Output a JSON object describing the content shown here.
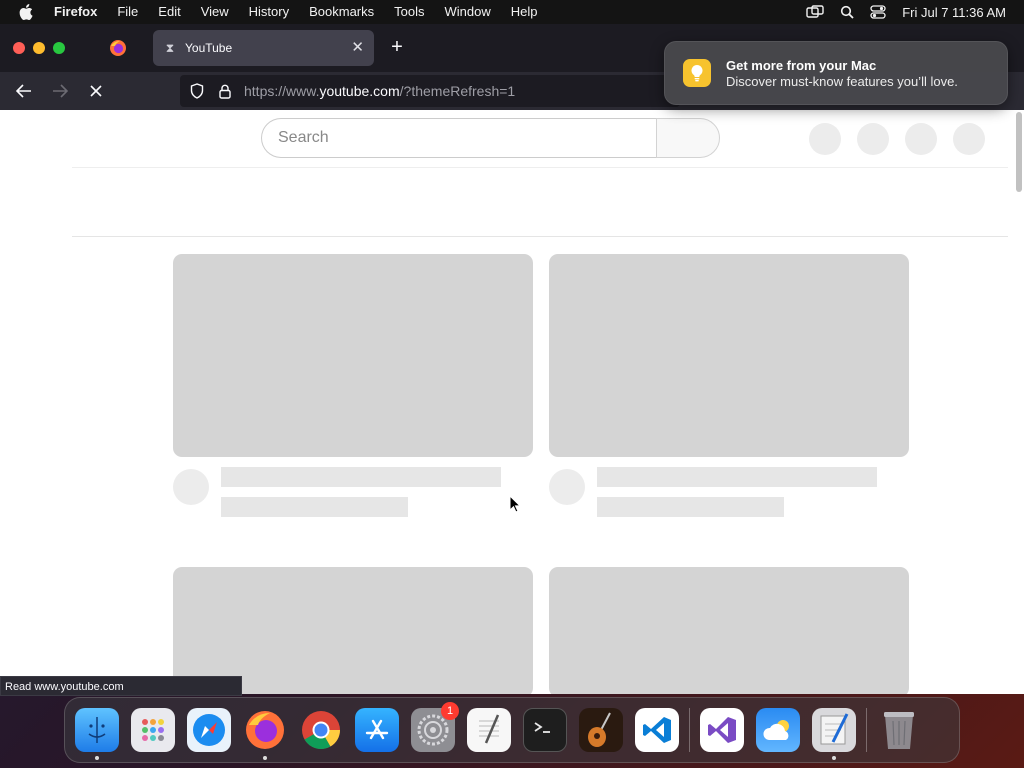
{
  "menubar": {
    "app_name": "Firefox",
    "menus": [
      "File",
      "Edit",
      "View",
      "History",
      "Bookmarks",
      "Tools",
      "Window",
      "Help"
    ],
    "datetime": "Fri Jul 7  11:36 AM"
  },
  "browser": {
    "tab_title": "YouTube",
    "url_prefix": "https://www.",
    "url_domain": "youtube.com",
    "url_suffix": "/?themeRefresh=1",
    "status_text": "Read www.youtube.com"
  },
  "notification": {
    "title": "Get more from your Mac",
    "body": "Discover must-know features you’ll love."
  },
  "page": {
    "search_placeholder": "Search"
  },
  "dock": {
    "items": [
      "finder-icon",
      "launchpad-icon",
      "safari-icon",
      "firefox-icon",
      "chrome-icon",
      "app-store-icon",
      "system-settings-icon",
      "textedit-icon",
      "terminal-icon",
      "garageband-icon",
      "vscode-icon",
      "visual-studio-icon",
      "weather-icon",
      "script-editor-icon",
      "trash-icon"
    ],
    "settings_badge": "1"
  },
  "colors": {
    "skeleton_thumb": "#d4d4d4",
    "skeleton_line": "#e6e6e6",
    "tab_active": "#42414d",
    "toolbar": "#2b2a33"
  }
}
